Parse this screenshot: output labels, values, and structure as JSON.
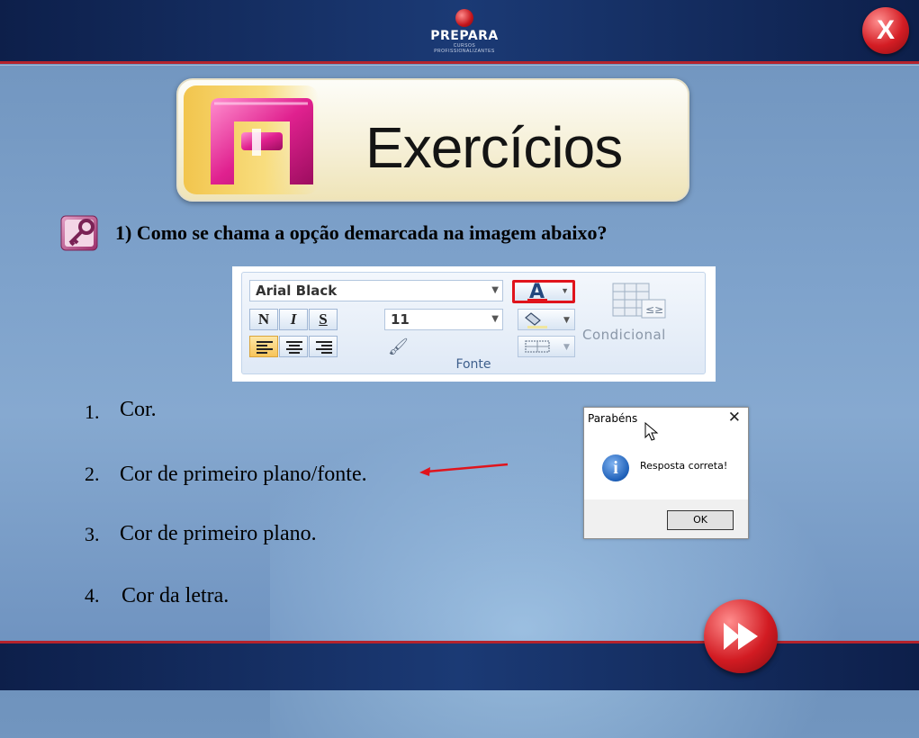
{
  "header": {
    "logo_text": "PREPARA",
    "logo_subtext": "CURSOS PROFISSIONALIZANTES",
    "close_label": "X"
  },
  "title_banner": {
    "title": "Exercícios"
  },
  "question": {
    "text": "1)  Como se chama a opção demarcada na imagem abaixo?"
  },
  "ribbon": {
    "font_name": "Arial Black",
    "font_size": "11",
    "bold_label": "N",
    "italic_label": "I",
    "underline_label": "S",
    "font_color_letter": "A",
    "conditional_label": "Condicional",
    "group_label": "Fonte",
    "highlight_color": "#e0141c"
  },
  "options": [
    {
      "number": "1.",
      "text": "Cor."
    },
    {
      "number": "2.",
      "text": "Cor de primeiro plano/fonte."
    },
    {
      "number": "3.",
      "text": "Cor de primeiro plano."
    },
    {
      "number": "4.",
      "text": "Cor da letra."
    }
  ],
  "dialog": {
    "title": "Parabéns",
    "close_label": "✕",
    "icon_letter": "i",
    "message": "Resposta correta!",
    "ok_label": "OK"
  },
  "colors": {
    "accent_red": "#b5232c",
    "bar_navy": "#1b3a75",
    "background_blue": "#7ea2cb"
  }
}
